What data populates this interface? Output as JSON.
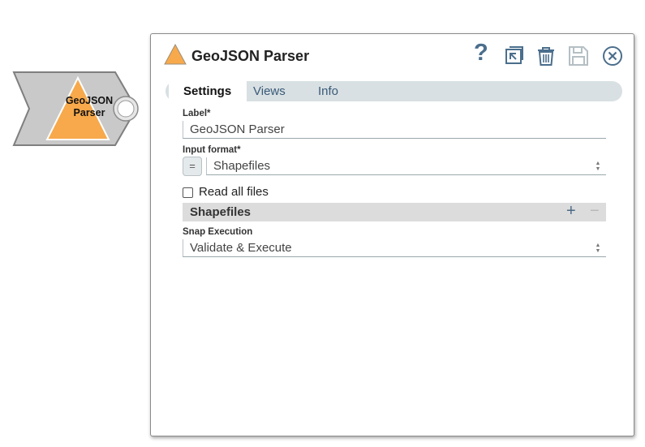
{
  "canvas": {
    "node": {
      "label": "GeoJSON Parser",
      "icon": "triangle-icon",
      "color": "#f7a94b"
    }
  },
  "dialog": {
    "title": "GeoJSON Parser",
    "title_icon": "triangle-icon",
    "actions": {
      "help": "?",
      "help_icon": "help-icon",
      "export_icon": "export-icon",
      "delete_icon": "trash-icon",
      "save_icon": "save-icon",
      "close_icon": "close-icon"
    },
    "tabs": [
      {
        "label": "Settings",
        "active": true
      },
      {
        "label": "Views",
        "active": false
      },
      {
        "label": "Info",
        "active": false
      }
    ],
    "fields": {
      "label": {
        "label": "Label*",
        "value": "GeoJSON Parser"
      },
      "input_format": {
        "label": "Input format*",
        "expression_toggle": "=",
        "value": "Shapefiles"
      },
      "read_all_files": {
        "label": "Read all files",
        "checked": false
      },
      "shapefiles_section": {
        "title": "Shapefiles",
        "add": "+",
        "remove": "−"
      },
      "snap_execution": {
        "label": "Snap Execution",
        "value": "Validate & Execute"
      }
    }
  },
  "colors": {
    "accent": "#f7a94b",
    "tab_bar": "#d8e0e3",
    "node_body": "#c9c9c9"
  }
}
